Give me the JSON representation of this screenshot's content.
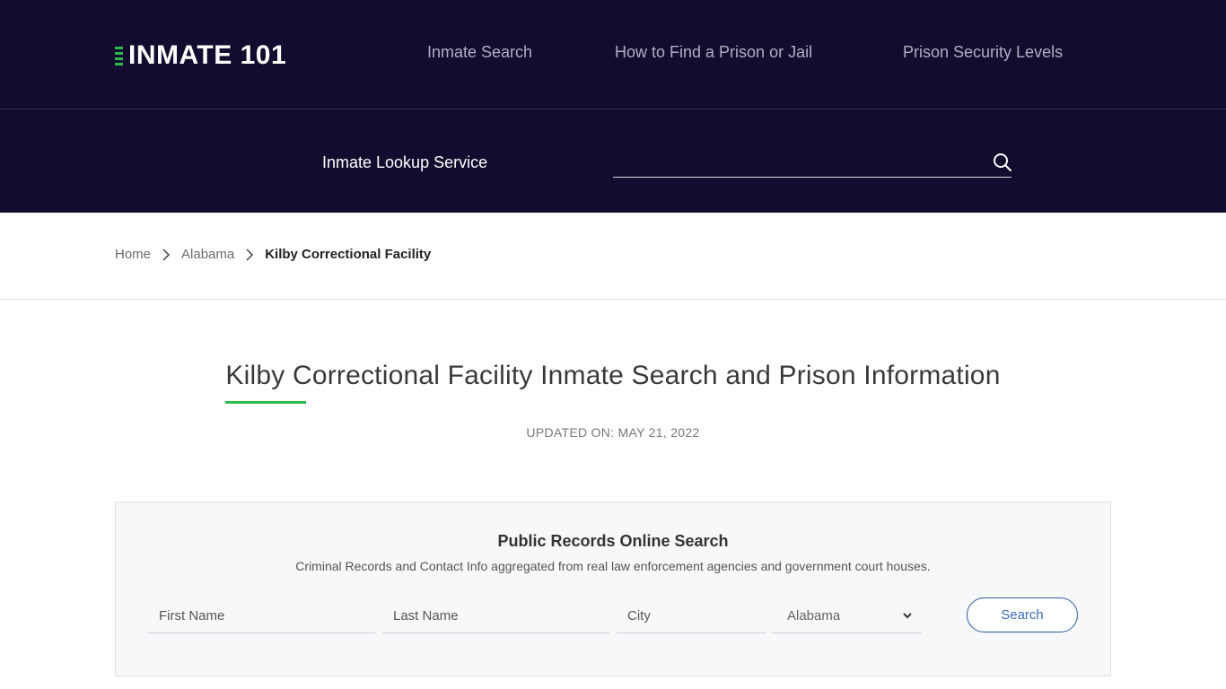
{
  "header": {
    "logo_text": "INMATE 101",
    "nav": [
      {
        "label": "Inmate Search"
      },
      {
        "label": "How to Find a Prison or Jail"
      },
      {
        "label": "Prison Security Levels"
      }
    ]
  },
  "lookup": {
    "label": "Inmate Lookup Service",
    "value": "",
    "search_icon": "search-icon"
  },
  "breadcrumb": {
    "items": [
      {
        "label": "Home"
      },
      {
        "label": "Alabama"
      }
    ],
    "current": "Kilby Correctional Facility"
  },
  "page": {
    "title": "Kilby Correctional Facility Inmate Search and Prison Information",
    "updated": "UPDATED ON: MAY 21, 2022"
  },
  "search_card": {
    "title": "Public Records Online Search",
    "subtitle": "Criminal Records and Contact Info aggregated from real law enforcement agencies and government court houses.",
    "first_name_placeholder": "First Name",
    "last_name_placeholder": "Last Name",
    "city_placeholder": "City",
    "state_selected": "Alabama",
    "search_label": "Search"
  },
  "colors": {
    "header_bg": "#130c2e",
    "accent_green": "#2db84b",
    "button_blue": "#3b6cb5"
  }
}
